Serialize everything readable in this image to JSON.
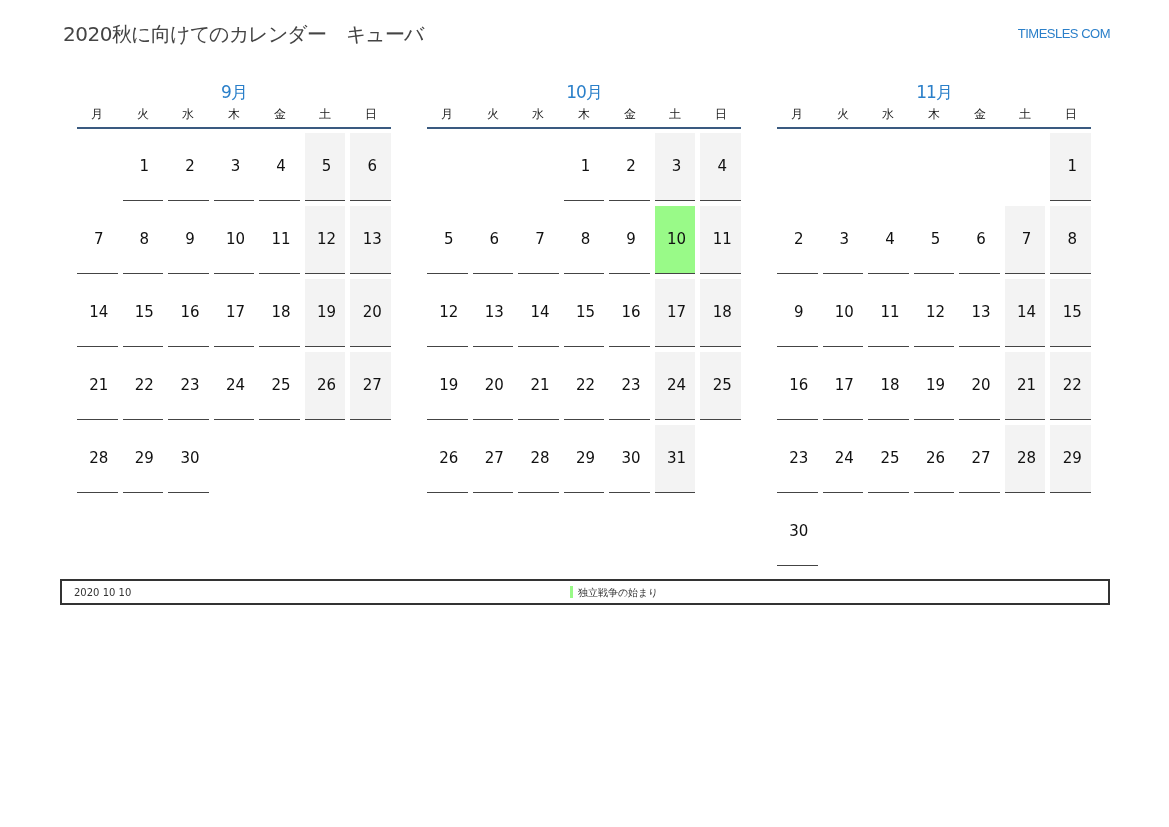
{
  "title": "2020秋に向けてのカレンダー　キューバ",
  "brand": "TIMESLES COM",
  "months": [
    {
      "title": "9月",
      "weekdays": [
        "月",
        "火",
        "水",
        "木",
        "金",
        "土",
        "日"
      ],
      "weeks": [
        [
          {
            "kind": "empty"
          },
          {
            "kind": "day",
            "day": "1",
            "weekend": false
          },
          {
            "kind": "day",
            "day": "2",
            "weekend": false
          },
          {
            "kind": "day",
            "day": "3",
            "weekend": false
          },
          {
            "kind": "day",
            "day": "4",
            "weekend": false
          },
          {
            "kind": "day",
            "day": "5",
            "weekend": true
          },
          {
            "kind": "day",
            "day": "6",
            "weekend": true
          }
        ],
        [
          {
            "kind": "day",
            "day": "7",
            "weekend": false
          },
          {
            "kind": "day",
            "day": "8",
            "weekend": false
          },
          {
            "kind": "day",
            "day": "9",
            "weekend": false
          },
          {
            "kind": "day",
            "day": "10",
            "weekend": false
          },
          {
            "kind": "day",
            "day": "11",
            "weekend": false
          },
          {
            "kind": "day",
            "day": "12",
            "weekend": true
          },
          {
            "kind": "day",
            "day": "13",
            "weekend": true
          }
        ],
        [
          {
            "kind": "day",
            "day": "14",
            "weekend": false
          },
          {
            "kind": "day",
            "day": "15",
            "weekend": false
          },
          {
            "kind": "day",
            "day": "16",
            "weekend": false
          },
          {
            "kind": "day",
            "day": "17",
            "weekend": false
          },
          {
            "kind": "day",
            "day": "18",
            "weekend": false
          },
          {
            "kind": "day",
            "day": "19",
            "weekend": true
          },
          {
            "kind": "day",
            "day": "20",
            "weekend": true
          }
        ],
        [
          {
            "kind": "day",
            "day": "21",
            "weekend": false
          },
          {
            "kind": "day",
            "day": "22",
            "weekend": false
          },
          {
            "kind": "day",
            "day": "23",
            "weekend": false
          },
          {
            "kind": "day",
            "day": "24",
            "weekend": false
          },
          {
            "kind": "day",
            "day": "25",
            "weekend": false
          },
          {
            "kind": "day",
            "day": "26",
            "weekend": true
          },
          {
            "kind": "day",
            "day": "27",
            "weekend": true
          }
        ],
        [
          {
            "kind": "day",
            "day": "28",
            "weekend": false
          },
          {
            "kind": "day",
            "day": "29",
            "weekend": false
          },
          {
            "kind": "day",
            "day": "30",
            "weekend": false
          },
          {
            "kind": "empty"
          },
          {
            "kind": "empty"
          },
          {
            "kind": "empty"
          },
          {
            "kind": "empty"
          }
        ]
      ]
    },
    {
      "title": "10月",
      "weekdays": [
        "月",
        "火",
        "水",
        "木",
        "金",
        "土",
        "日"
      ],
      "weeks": [
        [
          {
            "kind": "empty"
          },
          {
            "kind": "empty"
          },
          {
            "kind": "empty"
          },
          {
            "kind": "day",
            "day": "1",
            "weekend": false
          },
          {
            "kind": "day",
            "day": "2",
            "weekend": false
          },
          {
            "kind": "day",
            "day": "3",
            "weekend": true
          },
          {
            "kind": "day",
            "day": "4",
            "weekend": true
          }
        ],
        [
          {
            "kind": "day",
            "day": "5",
            "weekend": false
          },
          {
            "kind": "day",
            "day": "6",
            "weekend": false
          },
          {
            "kind": "day",
            "day": "7",
            "weekend": false
          },
          {
            "kind": "day",
            "day": "8",
            "weekend": false
          },
          {
            "kind": "day",
            "day": "9",
            "weekend": false
          },
          {
            "kind": "day",
            "day": "10",
            "color": "#99fa88"
          },
          {
            "kind": "day",
            "day": "11",
            "weekend": true
          }
        ],
        [
          {
            "kind": "day",
            "day": "12",
            "weekend": false
          },
          {
            "kind": "day",
            "day": "13",
            "weekend": false
          },
          {
            "kind": "day",
            "day": "14",
            "weekend": false
          },
          {
            "kind": "day",
            "day": "15",
            "weekend": false
          },
          {
            "kind": "day",
            "day": "16",
            "weekend": false
          },
          {
            "kind": "day",
            "day": "17",
            "weekend": true
          },
          {
            "kind": "day",
            "day": "18",
            "weekend": true
          }
        ],
        [
          {
            "kind": "day",
            "day": "19",
            "weekend": false
          },
          {
            "kind": "day",
            "day": "20",
            "weekend": false
          },
          {
            "kind": "day",
            "day": "21",
            "weekend": false
          },
          {
            "kind": "day",
            "day": "22",
            "weekend": false
          },
          {
            "kind": "day",
            "day": "23",
            "weekend": false
          },
          {
            "kind": "day",
            "day": "24",
            "weekend": true
          },
          {
            "kind": "day",
            "day": "25",
            "weekend": true
          }
        ],
        [
          {
            "kind": "day",
            "day": "26",
            "weekend": false
          },
          {
            "kind": "day",
            "day": "27",
            "weekend": false
          },
          {
            "kind": "day",
            "day": "28",
            "weekend": false
          },
          {
            "kind": "day",
            "day": "29",
            "weekend": false
          },
          {
            "kind": "day",
            "day": "30",
            "weekend": false
          },
          {
            "kind": "day",
            "day": "31",
            "weekend": true
          },
          {
            "kind": "empty"
          }
        ]
      ]
    },
    {
      "title": "11月",
      "weekdays": [
        "月",
        "火",
        "水",
        "木",
        "金",
        "土",
        "日"
      ],
      "weeks": [
        [
          {
            "kind": "empty"
          },
          {
            "kind": "empty"
          },
          {
            "kind": "empty"
          },
          {
            "kind": "empty"
          },
          {
            "kind": "empty"
          },
          {
            "kind": "empty"
          },
          {
            "kind": "day",
            "day": "1",
            "weekend": true
          }
        ],
        [
          {
            "kind": "day",
            "day": "2",
            "weekend": false
          },
          {
            "kind": "day",
            "day": "3",
            "weekend": false
          },
          {
            "kind": "day",
            "day": "4",
            "weekend": false
          },
          {
            "kind": "day",
            "day": "5",
            "weekend": false
          },
          {
            "kind": "day",
            "day": "6",
            "weekend": false
          },
          {
            "kind": "day",
            "day": "7",
            "weekend": true
          },
          {
            "kind": "day",
            "day": "8",
            "weekend": true
          }
        ],
        [
          {
            "kind": "day",
            "day": "9",
            "weekend": false
          },
          {
            "kind": "day",
            "day": "10",
            "weekend": false
          },
          {
            "kind": "day",
            "day": "11",
            "weekend": false
          },
          {
            "kind": "day",
            "day": "12",
            "weekend": false
          },
          {
            "kind": "day",
            "day": "13",
            "weekend": false
          },
          {
            "kind": "day",
            "day": "14",
            "weekend": true
          },
          {
            "kind": "day",
            "day": "15",
            "weekend": true
          }
        ],
        [
          {
            "kind": "day",
            "day": "16",
            "weekend": false
          },
          {
            "kind": "day",
            "day": "17",
            "weekend": false
          },
          {
            "kind": "day",
            "day": "18",
            "weekend": false
          },
          {
            "kind": "day",
            "day": "19",
            "weekend": false
          },
          {
            "kind": "day",
            "day": "20",
            "weekend": false
          },
          {
            "kind": "day",
            "day": "21",
            "weekend": true
          },
          {
            "kind": "day",
            "day": "22",
            "weekend": true
          }
        ],
        [
          {
            "kind": "day",
            "day": "23",
            "weekend": false
          },
          {
            "kind": "day",
            "day": "24",
            "weekend": false
          },
          {
            "kind": "day",
            "day": "25",
            "weekend": false
          },
          {
            "kind": "day",
            "day": "26",
            "weekend": false
          },
          {
            "kind": "day",
            "day": "27",
            "weekend": false
          },
          {
            "kind": "day",
            "day": "28",
            "weekend": true
          },
          {
            "kind": "day",
            "day": "29",
            "weekend": true
          }
        ],
        [
          {
            "kind": "day",
            "day": "30",
            "weekend": false
          },
          {
            "kind": "empty"
          },
          {
            "kind": "empty"
          },
          {
            "kind": "empty"
          },
          {
            "kind": "empty"
          },
          {
            "kind": "empty"
          },
          {
            "kind": "empty"
          }
        ]
      ]
    }
  ],
  "events": [
    {
      "date": "2020 10 10",
      "color": "#99fa88",
      "text": "独立戦争の始まり"
    }
  ]
}
